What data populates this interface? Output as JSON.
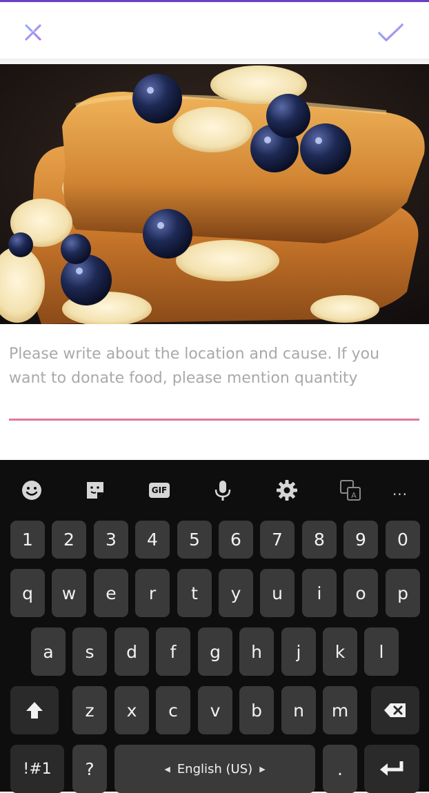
{
  "app": {
    "close_icon": "close-x-icon",
    "confirm_icon": "checkmark-icon",
    "accent": "#6a3fc4",
    "underline_color": "#e0779c"
  },
  "photo": {
    "subject": "french-toast-photo"
  },
  "note": {
    "placeholder": "Please write about the location and cause. If you want to donate food, please mention quantity",
    "value": ""
  },
  "keyboard": {
    "toolbar": {
      "emoji_icon": "emoji-icon",
      "sticker_icon": "sticker-icon",
      "gif": "GIF",
      "mic_icon": "mic-icon",
      "settings_icon": "gear-icon",
      "translate_icon": "translate-icon",
      "more": "..."
    },
    "row_numbers": [
      "1",
      "2",
      "3",
      "4",
      "5",
      "6",
      "7",
      "8",
      "9",
      "0"
    ],
    "row1": [
      "q",
      "w",
      "e",
      "r",
      "t",
      "y",
      "u",
      "i",
      "o",
      "p"
    ],
    "row2": [
      "a",
      "s",
      "d",
      "f",
      "g",
      "h",
      "j",
      "k",
      "l"
    ],
    "row3": [
      "z",
      "x",
      "c",
      "v",
      "b",
      "n",
      "m"
    ],
    "symbols": "!#1",
    "question": "?",
    "space": "English (US)",
    "period": "."
  }
}
